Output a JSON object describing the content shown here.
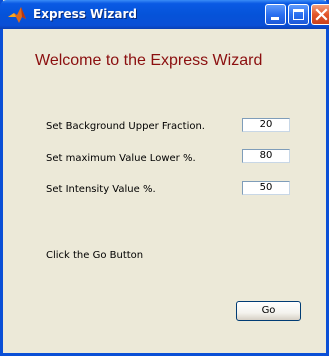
{
  "window": {
    "title": "Express Wizard",
    "colors": {
      "titlebar": "#0553d9",
      "client_background": "#ece9d8",
      "heading": "#8b0f0f",
      "close_button": "#e2552a"
    },
    "icons": {
      "app": "matlab-logo-icon",
      "minimize": "minimize-icon",
      "maximize": "maximize-icon",
      "close": "close-icon"
    }
  },
  "main": {
    "heading": "Welcome to the Express Wizard",
    "fields": [
      {
        "label": "Set Background Upper Fraction.",
        "value": "20"
      },
      {
        "label": "Set maximum Value Lower %.",
        "value": "80"
      },
      {
        "label": "Set Intensity Value %.",
        "value": "50"
      }
    ],
    "instruction": "Click the Go Button",
    "go_label": "Go"
  }
}
